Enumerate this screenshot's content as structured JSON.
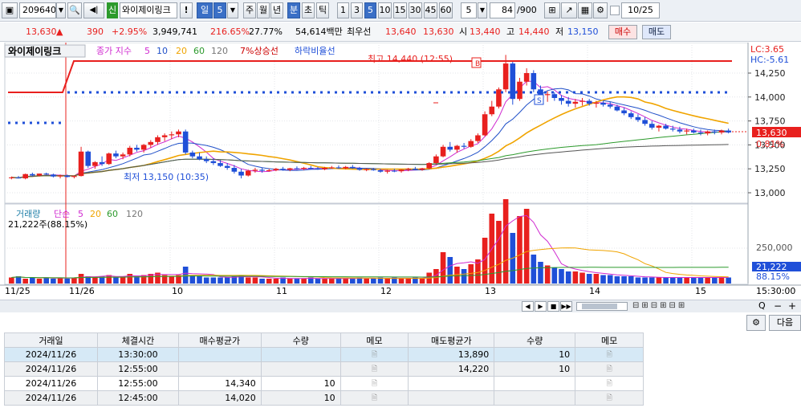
{
  "toolbar": {
    "code": "209640",
    "type_badge": "신",
    "name": "와이제이링크",
    "period_unit": "일",
    "period_value": "5",
    "periods": [
      "주",
      "월",
      "년",
      "분",
      "초",
      "틱"
    ],
    "intervals": [
      "1",
      "3",
      "5",
      "10",
      "15",
      "30",
      "45",
      "60"
    ],
    "count_value": "5",
    "range_value": "84",
    "range_max": "/900",
    "date": "10/25"
  },
  "price_bar": {
    "price": "13,630",
    "change_arrow": "▲",
    "change": "390",
    "change_pct": "+2.95%",
    "volume": "3,949,741",
    "vol_ratio": "216.65%",
    "turnover": "27.77%",
    "amount": "54,614백만",
    "ask_label": "최우선",
    "ask": "13,640",
    "bid": "13,630",
    "open_label": "시",
    "open": "13,440",
    "high_label": "고",
    "high": "14,440",
    "low_label": "저",
    "low": "13,150",
    "buy_label": "매수",
    "sell_label": "매도"
  },
  "chart": {
    "title": "와이제이링크",
    "ma_label": "종가 지수",
    "ma_periods": [
      "5",
      "10",
      "20",
      "60",
      "120"
    ],
    "line_7pct": "7%상승선",
    "line_down": "하락비율선",
    "high_note": "최고 14,440 (12:55)",
    "low_note": "최저 13,150 (10:35)",
    "lc": "LC:3.65",
    "hc": "HC:-5.61",
    "y_ticks": [
      "14,250",
      "14,000",
      "13,750",
      "13,500",
      "13,250",
      "13,000"
    ],
    "last_price": "13,630",
    "last_pct": "0.81%",
    "vol_label": "거래량",
    "vol_ma_label": "단순",
    "vol_ma_periods": [
      "5",
      "20",
      "60",
      "120"
    ],
    "vol_text": "21,222주(88.15%)",
    "vol_tick": "250,000",
    "vol_last": "21,222",
    "vol_pct": "88.15%",
    "x_labels": [
      "11/25",
      "11/26",
      "10",
      "11",
      "12",
      "13",
      "14",
      "15",
      "15:30:00"
    ],
    "marker_b": "B",
    "marker_s": "S",
    "colors": {
      "up": "#e8201e",
      "down": "#1f4fd8",
      "ma5": "#d02bd0",
      "ma10": "#2050c8",
      "ma20": "#f0a400",
      "ma60": "#2c9a2c",
      "ma120": "#555555"
    }
  },
  "nav": {
    "buttons": [
      "◀",
      "▶",
      "■",
      "▶▶"
    ],
    "minus": "−",
    "plus": "+",
    "zoom": "Q"
  },
  "grid": {
    "next_button": "다음",
    "columns": [
      "거래일",
      "체결시간",
      "매수평균가",
      "수량",
      "메모",
      "매도평균가",
      "수량",
      "메모"
    ],
    "rows": [
      {
        "date": "2024/11/26",
        "time": "13:30:00",
        "buy_price": "",
        "buy_qty": "",
        "sell_price": "13,890",
        "sell_qty": "10"
      },
      {
        "date": "2024/11/26",
        "time": "12:55:00",
        "buy_price": "",
        "buy_qty": "",
        "sell_price": "14,220",
        "sell_qty": "10"
      },
      {
        "date": "2024/11/26",
        "time": "12:55:00",
        "buy_price": "14,340",
        "buy_qty": "10",
        "sell_price": "",
        "sell_qty": ""
      },
      {
        "date": "2024/11/26",
        "time": "12:45:00",
        "buy_price": "14,020",
        "buy_qty": "10",
        "sell_price": "",
        "sell_qty": ""
      }
    ]
  }
}
